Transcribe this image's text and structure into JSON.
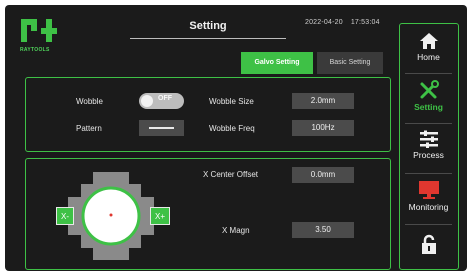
{
  "header": {
    "logo_text": "RAYTOOLS",
    "title": "Setting",
    "date": "2022-04-20",
    "time": "17:53:04"
  },
  "tabs": [
    {
      "label": "Galvo Setting",
      "active": true
    },
    {
      "label": "Basic Setting",
      "active": false
    }
  ],
  "wobble_panel": {
    "wobble_label": "Wobble",
    "wobble_toggle_text": "OFF",
    "pattern_label": "Pattern",
    "wobble_size_label": "Wobble Size",
    "wobble_size_value": "2.0mm",
    "wobble_freq_label": "Wobble Freq",
    "wobble_freq_value": "100Hz"
  },
  "galvo_panel": {
    "x_minus_label": "X-",
    "x_plus_label": "X+",
    "x_center_offset_label": "X Center Offset",
    "x_center_offset_value": "0.0mm",
    "x_magn_label": "X Magn",
    "x_magn_value": "3.50"
  },
  "nav": {
    "items": [
      {
        "label": "Home",
        "icon": "home-icon",
        "active": false
      },
      {
        "label": "Setting",
        "icon": "tools-icon",
        "active": true
      },
      {
        "label": "Process",
        "icon": "sliders-icon",
        "active": false
      },
      {
        "label": "Monitoring",
        "icon": "monitor-icon",
        "active": false
      },
      {
        "label": "",
        "icon": "lock-open-icon",
        "active": false
      }
    ]
  },
  "colors": {
    "accent": "#3ec146",
    "background": "#1b1b1b",
    "value_box": "#4b4b4b",
    "monitor_red": "#e0372f"
  }
}
